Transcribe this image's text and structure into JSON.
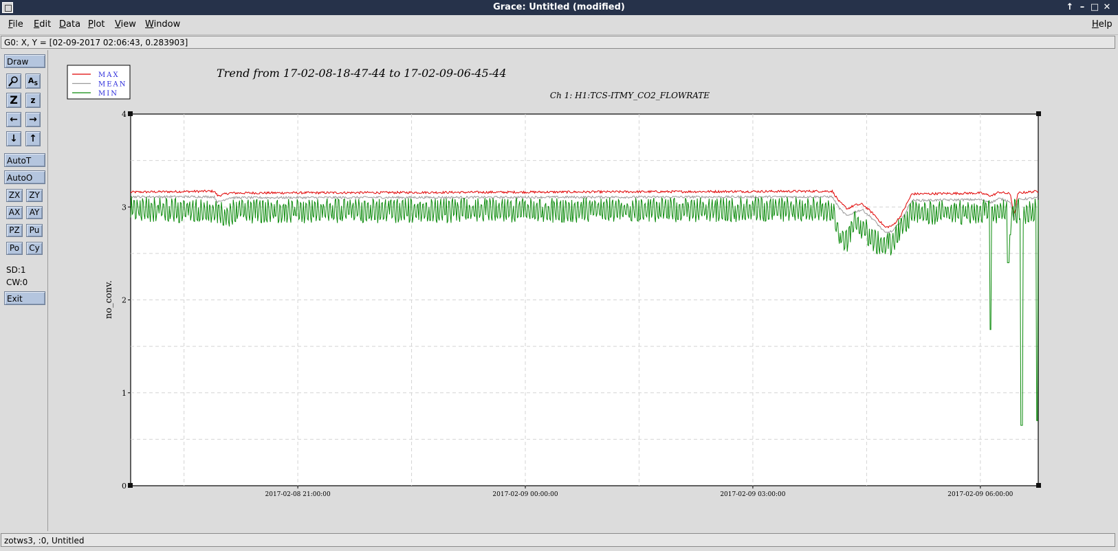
{
  "window": {
    "title": "Grace: Untitled (modified)",
    "controls": [
      "↑",
      "–",
      "□",
      "✕"
    ]
  },
  "menubar": {
    "items": [
      "File",
      "Edit",
      "Data",
      "Plot",
      "View",
      "Window"
    ],
    "help": "Help"
  },
  "locator": "G0: X, Y = [02-09-2017 02:06:43, 0.283903]",
  "toolbar": {
    "draw": "Draw",
    "autot": "AutoT",
    "autoo": "AutoO",
    "small_buttons": [
      "ZX",
      "ZY",
      "AX",
      "AY",
      "PZ",
      "Pu",
      "Po",
      "Cy"
    ],
    "sd": "SD:1",
    "cw": "CW:0",
    "exit": "Exit",
    "icons": [
      "magnifier-icon",
      "text-icon",
      "zoom-in-z-icon",
      "zoom-out-z-icon",
      "arrow-left-icon",
      "arrow-right-icon",
      "arrow-down-icon",
      "arrow-up-icon"
    ]
  },
  "status": "zotws3, :0, Untitled",
  "chart_data": {
    "type": "line",
    "title": "Trend from 17-02-08-18-47-44 to 17-02-09-06-45-44",
    "subtitle": "Ch 1: H1:TCS-ITMY_CO2_FLOWRATE",
    "xlabel": "",
    "ylabel": "no_conv.",
    "x_start": "2017-02-08 18:47:44",
    "x_end": "2017-02-09 06:45:44",
    "xlim_hours": [
      0,
      11.967
    ],
    "ylim": [
      0,
      4
    ],
    "yticks": [
      0,
      1,
      2,
      3,
      4
    ],
    "xticks": [
      {
        "hour": 2.204,
        "label": "2017-02-08 21:00:00"
      },
      {
        "hour": 5.204,
        "label": "2017-02-09 00:00:00"
      },
      {
        "hour": 8.204,
        "label": "2017-02-09 03:00:00"
      },
      {
        "hour": 11.204,
        "label": "2017-02-09 06:00:00"
      }
    ],
    "grid": true,
    "legend_position": "top-left",
    "series": [
      {
        "name": "MAX",
        "color": "#e00000",
        "baseline": 3.16,
        "profile": [
          [
            0,
            3.16
          ],
          [
            1.1,
            3.17
          ],
          [
            1.15,
            3.12
          ],
          [
            1.3,
            3.15
          ],
          [
            9.25,
            3.17
          ],
          [
            9.35,
            3.05
          ],
          [
            9.45,
            2.98
          ],
          [
            9.55,
            3.02
          ],
          [
            9.65,
            3.03
          ],
          [
            9.8,
            2.92
          ],
          [
            9.95,
            2.78
          ],
          [
            10.05,
            2.8
          ],
          [
            10.15,
            2.9
          ],
          [
            10.3,
            3.14
          ],
          [
            11.2,
            3.15
          ],
          [
            11.35,
            3.12
          ],
          [
            11.45,
            3.16
          ],
          [
            11.6,
            3.14
          ],
          [
            11.65,
            2.9
          ],
          [
            11.7,
            3.15
          ],
          [
            11.967,
            3.17
          ]
        ]
      },
      {
        "name": "MEAN",
        "color": "#9a9a9a",
        "baseline": 3.11,
        "profile": [
          [
            0,
            3.11
          ],
          [
            1.1,
            3.11
          ],
          [
            1.15,
            3.05
          ],
          [
            1.3,
            3.1
          ],
          [
            9.25,
            3.11
          ],
          [
            9.35,
            2.98
          ],
          [
            9.45,
            2.9
          ],
          [
            9.55,
            2.95
          ],
          [
            9.65,
            2.97
          ],
          [
            9.8,
            2.86
          ],
          [
            9.95,
            2.72
          ],
          [
            10.05,
            2.74
          ],
          [
            10.15,
            2.84
          ],
          [
            10.3,
            3.07
          ],
          [
            11.2,
            3.08
          ],
          [
            11.35,
            3.05
          ],
          [
            11.45,
            3.09
          ],
          [
            11.6,
            3.06
          ],
          [
            11.65,
            2.85
          ],
          [
            11.7,
            3.08
          ],
          [
            11.967,
            3.1
          ]
        ]
      },
      {
        "name": "MIN",
        "color": "#0a8a0a",
        "baseline": 2.95,
        "spikes": [
          [
            11.34,
            1.68
          ],
          [
            11.57,
            2.4
          ],
          [
            11.6,
            2.7
          ],
          [
            11.75,
            0.65
          ],
          [
            11.95,
            0.7
          ]
        ],
        "profile": [
          [
            0,
            2.95
          ],
          [
            1.2,
            2.9
          ],
          [
            1.25,
            2.8
          ],
          [
            1.35,
            2.92
          ],
          [
            9.25,
            2.94
          ],
          [
            9.35,
            2.65
          ],
          [
            9.45,
            2.6
          ],
          [
            9.55,
            2.8
          ],
          [
            9.65,
            2.75
          ],
          [
            9.8,
            2.6
          ],
          [
            9.95,
            2.55
          ],
          [
            10.05,
            2.58
          ],
          [
            10.15,
            2.75
          ],
          [
            10.3,
            2.9
          ],
          [
            11.967,
            2.92
          ]
        ]
      }
    ]
  }
}
